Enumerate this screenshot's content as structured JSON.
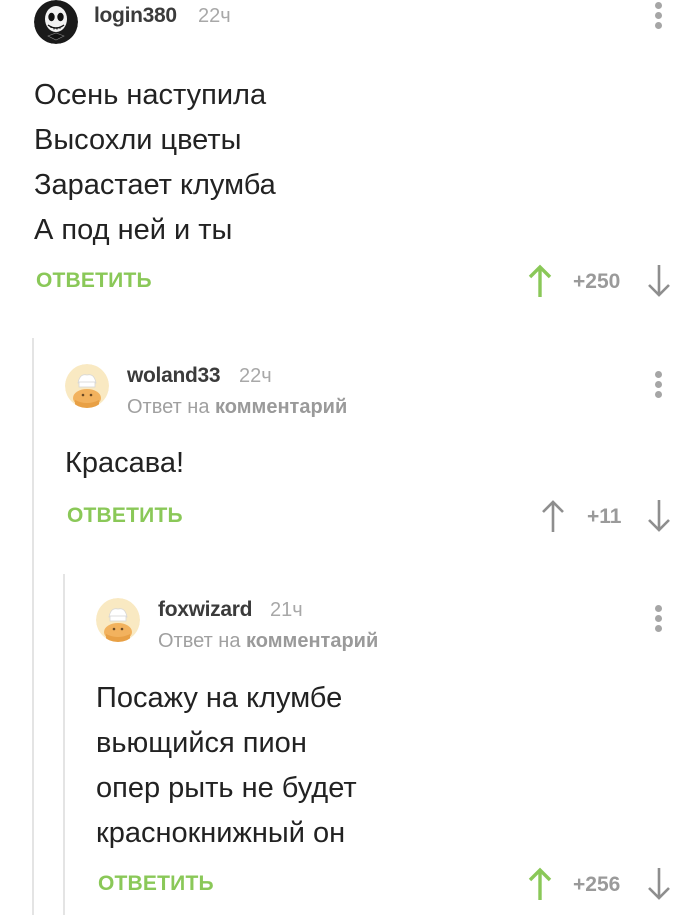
{
  "comments": [
    {
      "username": "login380",
      "time": "22ч",
      "reply_to_prefix": "",
      "reply_to_link": "",
      "lines": [
        "Осень наступила",
        "Высохли цветы",
        "Зарастает клумба",
        "А под ней и ты"
      ],
      "reply_label": "ОТВЕТИТЬ",
      "rating": "+250",
      "upvoted": true,
      "avatar": "jack-skellington-avatar"
    },
    {
      "username": "woland33",
      "time": "22ч",
      "reply_to_prefix": "Ответ на",
      "reply_to_link": "комментарий",
      "lines": [
        "Красава!"
      ],
      "reply_label": "ОТВЕТИТЬ",
      "rating": "+11",
      "upvoted": false,
      "avatar": "default-chef-avatar"
    },
    {
      "username": "foxwizard",
      "time": "21ч",
      "reply_to_prefix": "Ответ на",
      "reply_to_link": "комментарий",
      "lines": [
        "Посажу на клумбе",
        "вьющийся пион",
        "опер рыть не будет",
        "краснокнижный он"
      ],
      "reply_label": "ОТВЕТИТЬ",
      "rating": "+256",
      "upvoted": true,
      "avatar": "default-chef-avatar"
    }
  ],
  "colors": {
    "accent_green": "#8ac858",
    "muted_gray": "#9a9a9a",
    "thread_line": "#e4e4e4"
  },
  "icons": {
    "upvote": "arrow-up-icon",
    "downvote": "arrow-down-icon",
    "menu": "more-vertical-icon"
  }
}
